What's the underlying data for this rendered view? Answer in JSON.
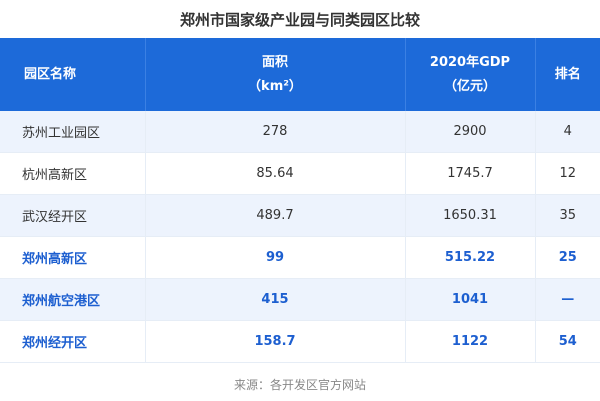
{
  "title": "郑州市国家级产业园与同类园区比较",
  "header": {
    "col1": "园区名称",
    "col2_line1": "面积",
    "col2_line2": "（km²）",
    "col3_line1": "2020年GDP",
    "col3_line2": "（亿元）",
    "col4": "排名"
  },
  "rows": [
    {
      "name": "苏州工业园区",
      "area": "278",
      "gdp": "2900",
      "rank": "4",
      "highlight": false
    },
    {
      "name": "杭州高新区",
      "area": "85.64",
      "gdp": "1745.7",
      "rank": "12",
      "highlight": false
    },
    {
      "name": "武汉经开区",
      "area": "489.7",
      "gdp": "1650.31",
      "rank": "35",
      "highlight": false
    },
    {
      "name": "郑州高新区",
      "area": "99",
      "gdp": "515.22",
      "rank": "25",
      "highlight": true
    },
    {
      "name": "郑州航空港区",
      "area": "415",
      "gdp": "1041",
      "rank": "—",
      "highlight": true
    },
    {
      "name": "郑州经开区",
      "area": "158.7",
      "gdp": "1122",
      "rank": "54",
      "highlight": true
    }
  ],
  "footer": "来源：各开发区官方网站",
  "colors": {
    "header_bg": "#1d6ad9",
    "highlight_text": "#1d5fd0",
    "stripe_bg": "#edf3fd"
  }
}
